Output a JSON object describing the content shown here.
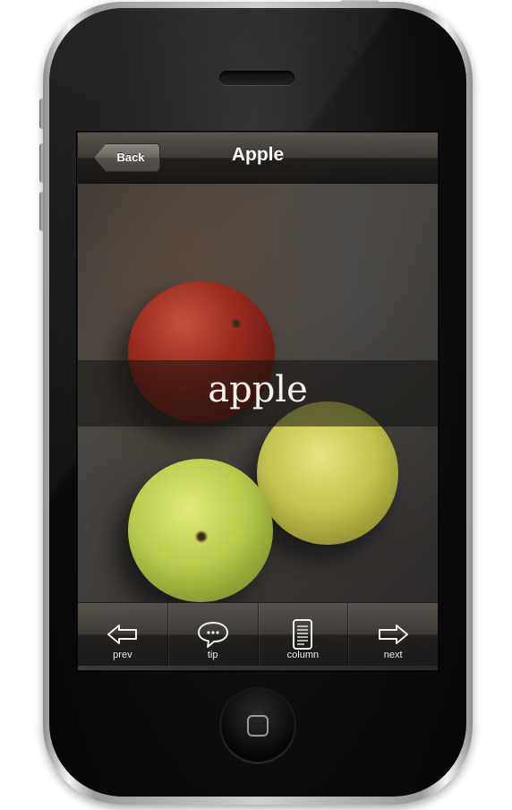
{
  "nav": {
    "back_label": "Back",
    "title": "Apple"
  },
  "hero": {
    "title_text": "apple"
  },
  "toolbar": {
    "items": [
      {
        "label": "prev",
        "icon": "arrow-left-icon"
      },
      {
        "label": "tip",
        "icon": "speech-bubble-icon"
      },
      {
        "label": "column",
        "icon": "document-icon"
      },
      {
        "label": "next",
        "icon": "arrow-right-icon"
      }
    ]
  },
  "colors": {
    "bar_dark": "#1e1c1a",
    "bar_light": "#5c5650",
    "text": "#ffffff"
  }
}
